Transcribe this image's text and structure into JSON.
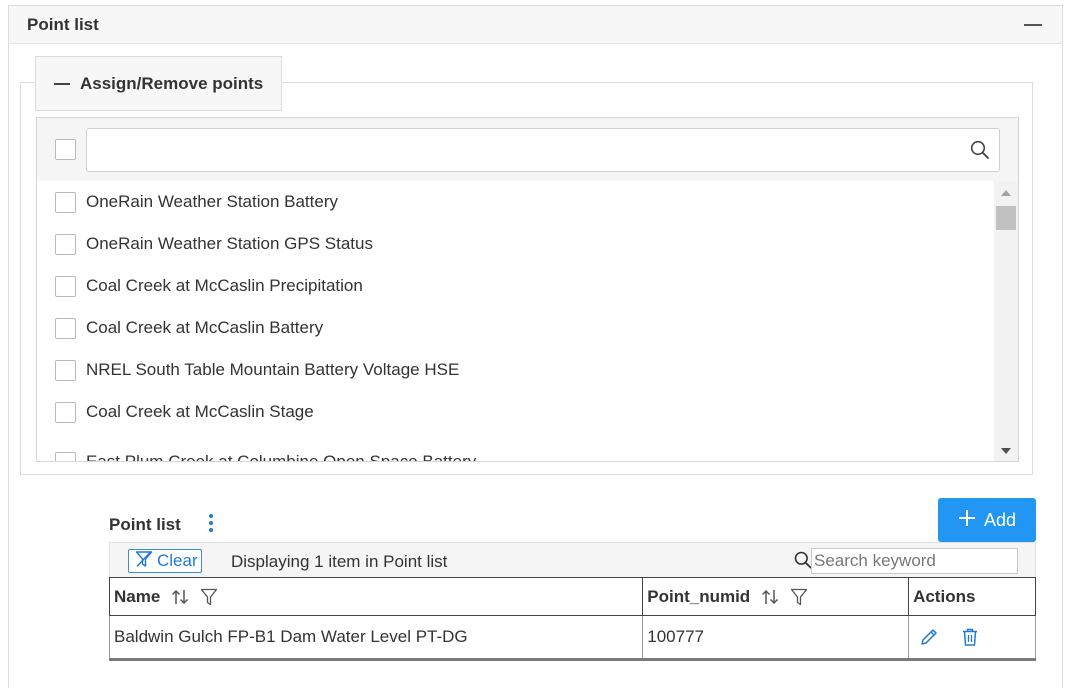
{
  "panel": {
    "title": "Point list"
  },
  "assign": {
    "legend_label": "Assign/Remove points",
    "search_value": "",
    "items": [
      "OneRain Weather Station Battery",
      "OneRain Weather Station GPS Status",
      "Coal Creek at McCaslin Precipitation",
      "Coal Creek at McCaslin Battery",
      "NREL South Table Mountain Battery Voltage HSE",
      "Coal Creek at McCaslin Stage",
      "East Plum Creek at Columbine Open Space Battery"
    ]
  },
  "grid": {
    "title": "Point list",
    "add_label": "Add",
    "clear_label": "Clear",
    "status_text": "Displaying 1 item in Point list",
    "search_placeholder": "Search keyword",
    "columns": [
      "Name",
      "Point_numid",
      "Actions"
    ],
    "rows": [
      {
        "name": "Baldwin Gulch FP-B1 Dam Water Level PT-DG",
        "point_numid": "100777"
      }
    ]
  },
  "icons": {
    "collapse": "minus-icon",
    "search": "search-icon",
    "sort": "sort-icon",
    "filter": "filter-icon",
    "edit": "pencil-icon",
    "delete": "trash-icon",
    "add": "plus-icon",
    "menu": "kebab-menu-icon"
  },
  "colors": {
    "accent": "#2196f3",
    "link": "#1f7bd6"
  }
}
